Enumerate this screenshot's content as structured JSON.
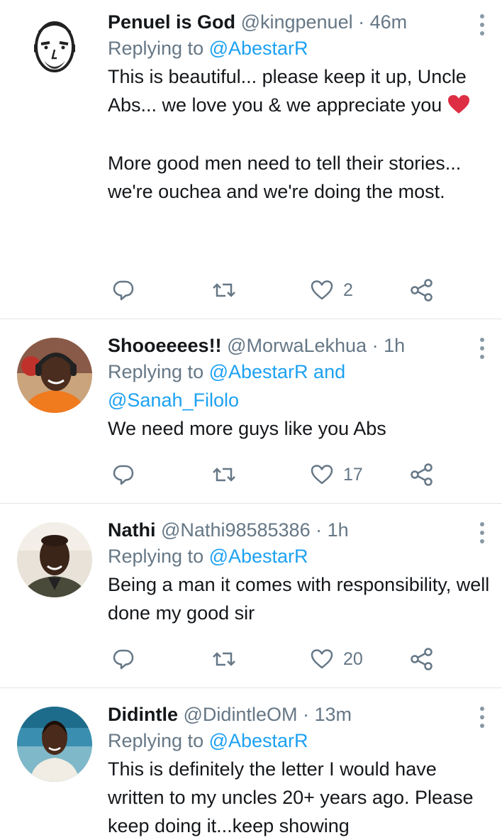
{
  "colors": {
    "link": "#1da1f2",
    "secondary": "#657786",
    "text": "#14171a",
    "icon": "#657786",
    "divider": "#e1e4e6"
  },
  "tweets": [
    {
      "name": "Penuel is God",
      "handle": "@kingpenuel",
      "separator": "·",
      "time": "46m",
      "replying_prefix": "Replying to ",
      "replying_to": "@AbestarR",
      "replying_to_extra": "",
      "body_paragraph_1": "This is beautiful... please keep it up, Uncle Abs... we love you & we appreciate you",
      "body_emoji": "red-heart-emoji",
      "body_paragraph_2": "More good men need to tell their stories... we're ouchea and we're doing the most.",
      "reply_count": "",
      "retweet_count": "",
      "like_count": "2"
    },
    {
      "name": "Shooeeees!!",
      "handle": "@MorwaLekhua",
      "separator": "·",
      "time": "1h",
      "replying_prefix": "Replying to ",
      "replying_to": "@AbestarR and",
      "replying_to_extra": "@Sanah_Filolo",
      "body_paragraph_1": "We need more guys like you Abs",
      "reply_count": "",
      "retweet_count": "",
      "like_count": "17"
    },
    {
      "name": "Nathi",
      "handle": "@Nathi98585386",
      "separator": "·",
      "time": "1h",
      "replying_prefix": "Replying to ",
      "replying_to": "@AbestarR",
      "replying_to_extra": "",
      "body_paragraph_1": "Being a man it comes with responsibility, well done my good sir",
      "reply_count": "",
      "retweet_count": "",
      "like_count": "20"
    },
    {
      "name": "Didintle",
      "handle": "@DidintleOM",
      "separator": "·",
      "time": "13m",
      "replying_prefix": "Replying to ",
      "replying_to": "@AbestarR",
      "replying_to_extra": "",
      "body_paragraph_1": "This is definitely the letter I would have written to my uncles 20+ years ago. Please keep doing it...keep showing"
    }
  ],
  "icons": {
    "reply": "reply-icon",
    "retweet": "retweet-icon",
    "like": "heart-icon",
    "share": "share-icon",
    "more": "more-vertical-icon"
  }
}
